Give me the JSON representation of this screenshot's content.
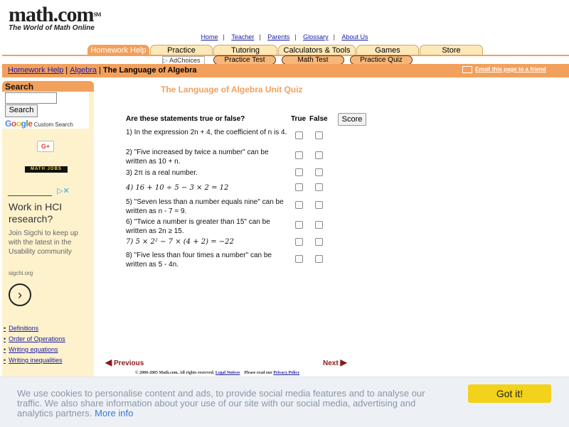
{
  "logo": {
    "word": "math.com",
    "tm": "SM",
    "tagline": "The World of Math Online"
  },
  "toplinks": [
    "Home",
    "Teacher",
    "Parents",
    "Glossary",
    "About Us"
  ],
  "tabs": [
    "Homework Help",
    "Practice",
    "Tutoring",
    "Calculators & Tools",
    "Games",
    "Store"
  ],
  "subnav": {
    "adchoices": "AdChoices",
    "pills": [
      "Practice Test",
      "Math Test",
      "Practice Quiz"
    ]
  },
  "breadcrumb": {
    "homework_help": "Homework Help",
    "algebra": "Algebra",
    "current": "The Language of Algebra",
    "sep": "|"
  },
  "email_page": "Email this page to a friend",
  "sidebar": {
    "search_title": "Search",
    "search_button": "Search",
    "google": "Google",
    "custom_search": "Custom Search",
    "gplus": "G+",
    "mathjobs": "MATH JOBS",
    "ad": {
      "close": "▷✕",
      "headline": "Work in HCI research?",
      "body": "Join Sigchi to keep up with the latest in the Usability community",
      "domain": "sigchi.org"
    },
    "links": [
      "Definitions",
      "Order of Operations",
      "Writing equations",
      "Writing inequalities"
    ]
  },
  "quiz": {
    "title": "The Language of Algebra Unit Quiz",
    "heading": "Are these statements true or false?",
    "col_true": "True",
    "col_false": "False",
    "score": "Score",
    "questions": [
      "1) In the expression 2n + 4, the coefficient of n is 4.",
      "2) \"Five increased by twice a number\" can be written as 10 + n.",
      "3) 2π is a real number.",
      "4) 16 + 10 ÷ 5 − 3 × 2 = 12",
      "5) \"Seven less than a number equals nine\" can be written as n - 7 = 9.",
      "6) \"Twice a number is greater than 15\" can be written as 2n ≥ 15.",
      "7) 5 × 2² − 7 × (4 + 2) = −22",
      "8) \"Five less than four times a number\" can be written as 5 - 4n."
    ]
  },
  "nav": {
    "previous": "Previous",
    "next": "Next"
  },
  "copyright": {
    "text": "© 2000-2005 Math.com. All rights reserved.",
    "legal": "Legal Notices",
    "privacy_pre": "Please read our",
    "privacy": "Privacy Policy"
  },
  "cookie": {
    "text": "We use cookies to personalise content and ads, to provide social media features and to analyse our traffic. We also share information about your use of our site with our social media, advertising and analytics partners.",
    "more": "More info",
    "button": "Got it!"
  },
  "colors": {
    "orange": "#f2a05c",
    "tab_bg": "#fde9b8",
    "sidebar_bg": "#fdf2cc",
    "cookie_button": "#f2d21a",
    "link": "#1a1aa6"
  }
}
